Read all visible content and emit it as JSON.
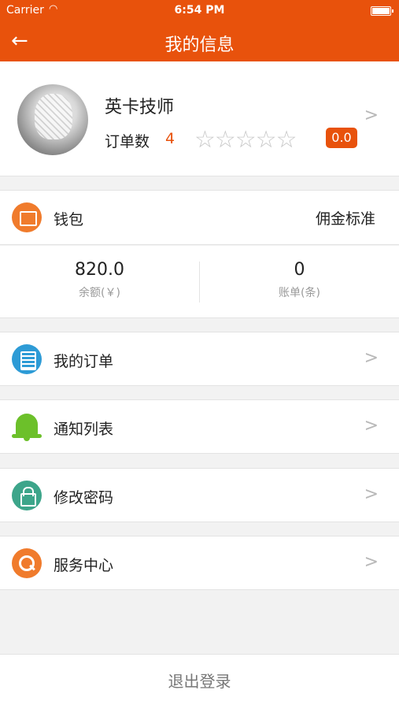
{
  "status_bar": {
    "carrier": "Carrier",
    "time": "6:54 PM"
  },
  "nav": {
    "title": "我的信息",
    "back_icon": "←"
  },
  "profile": {
    "name": "英卡技师",
    "orders_label": "订单数",
    "orders_count": "4",
    "stars_text": "☆☆☆☆☆",
    "stars_filled": 0,
    "stars_total": 5,
    "rating": "0.0",
    "chevron": ">"
  },
  "wallet": {
    "label": "钱包",
    "commission_label": "佣金标准"
  },
  "stats": {
    "balance_value": "820.0",
    "balance_label": "余额(￥)",
    "bills_value": "0",
    "bills_label": "账单(条)"
  },
  "menu": [
    {
      "label": "我的订单",
      "chevron": ">"
    },
    {
      "label": "通知列表",
      "chevron": ">"
    },
    {
      "label": "修改密码",
      "chevron": ">"
    },
    {
      "label": "服务中心",
      "chevron": ">"
    }
  ],
  "logout_label": "退出登录",
  "colors": {
    "accent": "#e8520c"
  }
}
